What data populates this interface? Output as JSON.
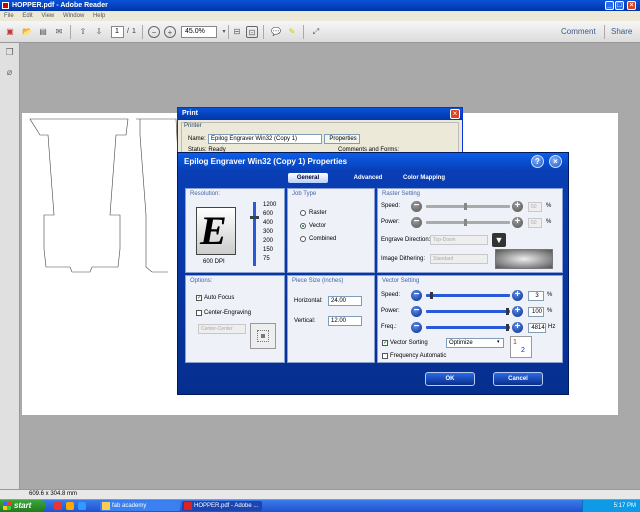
{
  "window": {
    "title": "HOPPER.pdf - Adobe Reader"
  },
  "menu": [
    "File",
    "Edit",
    "View",
    "Window",
    "Help"
  ],
  "toolbar": {
    "page_current": "1",
    "page_sep": "/",
    "page_total": "1",
    "zoom": "45.0%",
    "comment_label": "Comment",
    "share_label": "Share"
  },
  "status": {
    "page_size": "609.6 x 304.8 mm"
  },
  "print_dialog": {
    "title": "Print",
    "group_label": "Printer",
    "name_label": "Name:",
    "printer": "Epilog Engraver Win32 (Copy 1)",
    "properties_label": "Properties",
    "status_label": "Status: Ready",
    "comments_label": "Comments and Forms:"
  },
  "epilog": {
    "title": "Epilog Engraver Win32 (Copy 1) Properties",
    "tabs": [
      "General",
      "Advanced",
      "Color Mapping"
    ],
    "resolution": {
      "header": "Resolution:",
      "values": [
        "1200",
        "600",
        "400",
        "300",
        "200",
        "150",
        "75"
      ],
      "current": "600 DPI",
      "logo_letter": "E"
    },
    "job_type": {
      "header": "Job Type",
      "options": [
        "Raster",
        "Vector",
        "Combined"
      ],
      "selected": "Vector"
    },
    "raster": {
      "header": "Raster Setting",
      "speed_label": "Speed:",
      "speed_value": "50",
      "power_label": "Power:",
      "power_value": "50",
      "direction_label": "Engrave Direction:",
      "direction_value": "Top-Down",
      "dither_label": "Image Dithering:",
      "dither_value": "Standard",
      "pct": "%"
    },
    "options": {
      "header": "Options:",
      "auto_focus": "Auto Focus",
      "center_engraving": "Center-Engraving",
      "center_value": "Center-Center"
    },
    "piece": {
      "header": "Piece Size (inches)",
      "horizontal_label": "Horizontal:",
      "horizontal_value": "24.00",
      "vertical_label": "Vertical:",
      "vertical_value": "12.00"
    },
    "vector": {
      "header": "Vector Setting",
      "speed_label": "Speed:",
      "speed_value": "3",
      "power_label": "Power:",
      "power_value": "100",
      "freq_label": "Freq.:",
      "freq_value": "4814",
      "pct": "%",
      "hz": "Hz",
      "sorting_label": "Vector Sorting",
      "sorting_value": "Optimize",
      "frequency_auto": "Frequency Automatic"
    },
    "ok_label": "OK",
    "cancel_label": "Cancel"
  },
  "taskbar": {
    "start": "start",
    "tasks": [
      "fab academy",
      "HOPPER.pdf - Adobe ..."
    ],
    "clock": "5:17 PM"
  },
  "colors": {
    "xp_blue": "#0a52d8",
    "epilog_bg": "#0a3fb8",
    "start_green": "#3ca53c"
  }
}
